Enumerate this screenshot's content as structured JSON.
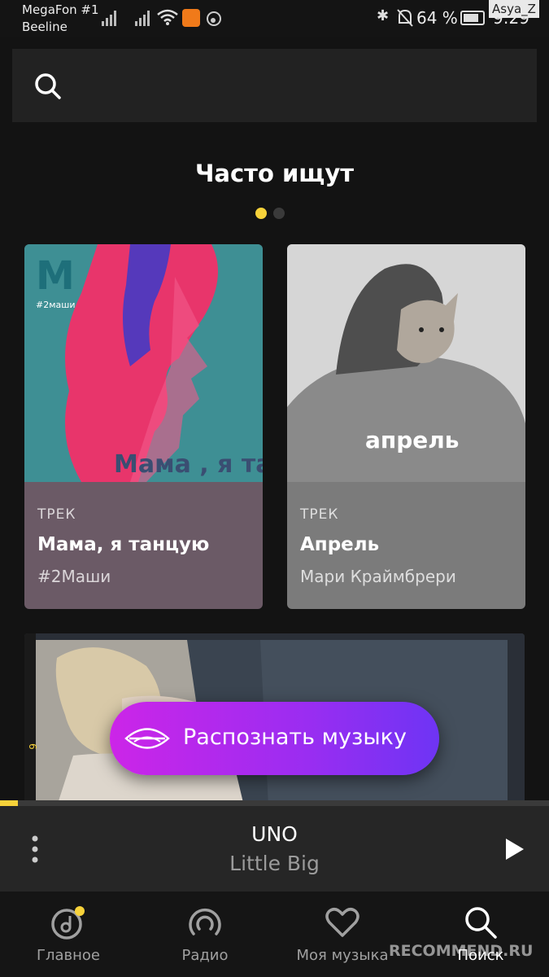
{
  "status_bar": {
    "carrier_1": "MegaFon #1",
    "carrier_2": "Beeline",
    "battery_percent": "64 %",
    "time": "9:29",
    "watermark_user": "Asya_Z"
  },
  "search": {
    "icon": "search-icon"
  },
  "section": {
    "title": "Часто ищут",
    "pages": 2,
    "active_page": 1
  },
  "cards": [
    {
      "type": "ТРЕК",
      "title": "Мама, я танцую",
      "artist": "#2Маши",
      "cover_logo": "#2маши",
      "cover_text": "Мама , я танцую"
    },
    {
      "type": "ТРЕК",
      "title": "Апрель",
      "artist": "Мари Краймбрери",
      "cover_text": "апрель"
    }
  ],
  "banner": {
    "side_marker": "6"
  },
  "recognize_button": {
    "label": "Распознать музыку",
    "icon": "sound-wave-icon"
  },
  "player": {
    "track": "UNO",
    "artist": "Little Big",
    "progress": 0.033
  },
  "tabs": [
    {
      "label": "Главное",
      "icon": "home-music-icon",
      "active": false
    },
    {
      "label": "Радио",
      "icon": "radio-icon",
      "active": false
    },
    {
      "label": "Моя музыка",
      "icon": "heart-icon",
      "active": false
    },
    {
      "label": "Поиск",
      "icon": "search-icon",
      "active": true
    }
  ],
  "watermark": "RECOMMEND.RU",
  "colors": {
    "accent_yellow": "#f7d23a",
    "button_gradient_start": "#cc25e8",
    "button_gradient_end": "#6e34f4",
    "background": "#131313"
  }
}
